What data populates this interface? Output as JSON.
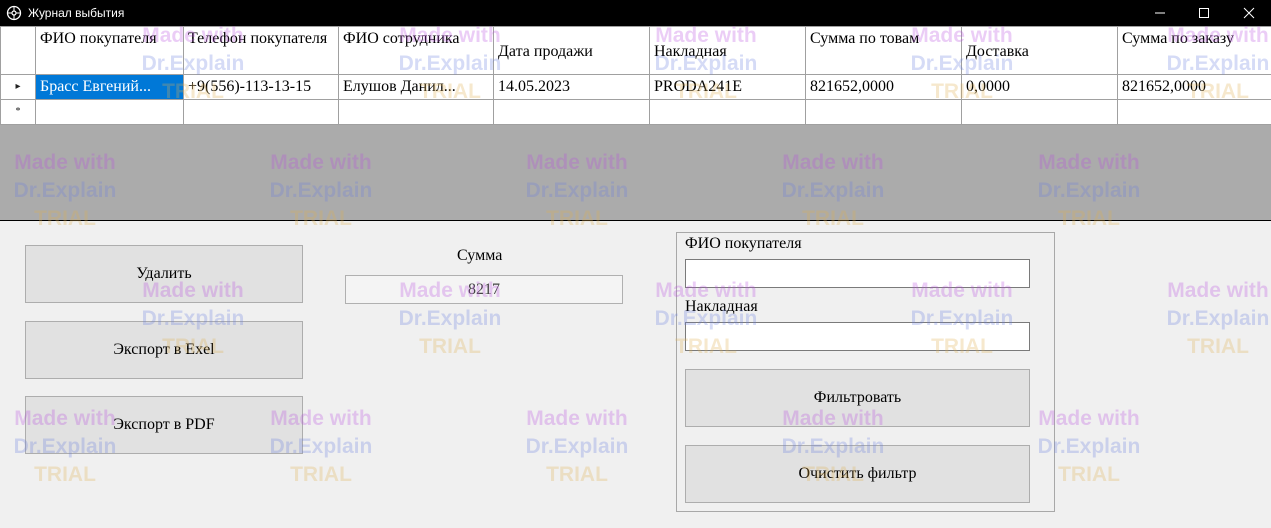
{
  "window": {
    "title": "Журнал выбытия",
    "minimize_icon": "minimize-icon",
    "maximize_icon": "maximize-icon",
    "close_icon": "close-icon"
  },
  "grid": {
    "columns": [
      "ФИО покупателя",
      "Телефон покупателя",
      "ФИО сотрудника",
      "Дата продажи",
      "Накладная",
      "Сумма по товам",
      "Доставка",
      "Сумма по заказу"
    ],
    "rows": [
      {
        "marker": "▸",
        "cells": [
          "Брасс Евгений...",
          "+9(556)-113-13-15",
          "Елушов Данил...",
          "14.05.2023",
          "PRODA241E",
          "821652,0000",
          "0,0000",
          "821652,0000"
        ]
      }
    ],
    "new_row_marker": "*",
    "selection_color": "#0078d7",
    "background_color": "#ababab"
  },
  "actions": {
    "delete": "Удалить",
    "export_excel": "Экспорт в Exel",
    "export_pdf": "Экспорт в PDF"
  },
  "sum": {
    "label": "Сумма",
    "value": "8217"
  },
  "filter": {
    "buyer_label": "ФИО покупателя",
    "buyer_value": "",
    "invoice_label": "Накладная",
    "invoice_value": "",
    "apply": "Фильтровать",
    "clear": "Очистить фильтр"
  },
  "watermark": {
    "line1": "Made with",
    "line2": "Dr.Explain",
    "line3": "TRIAL"
  }
}
